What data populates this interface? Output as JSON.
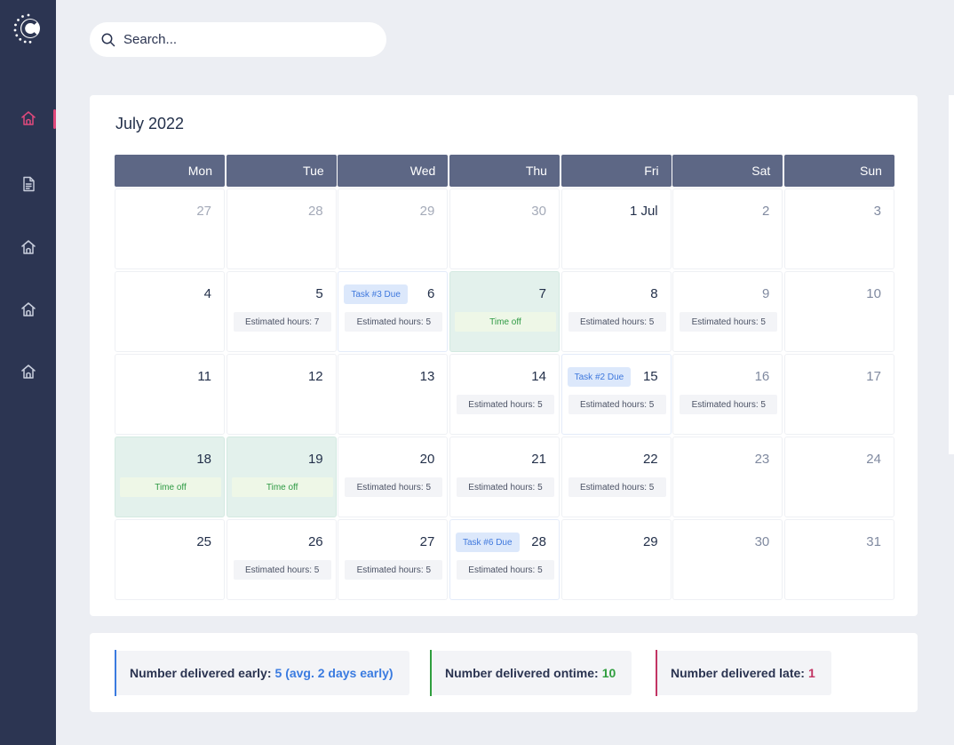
{
  "search": {
    "placeholder": "Search..."
  },
  "calendar": {
    "month_title": "July 2022",
    "weekdays": [
      "Mon",
      "Tue",
      "Wed",
      "Thu",
      "Fri",
      "Sat",
      "Sun"
    ],
    "weeks": [
      [
        {
          "num": "27",
          "style": "muted"
        },
        {
          "num": "28",
          "style": "muted"
        },
        {
          "num": "29",
          "style": "muted"
        },
        {
          "num": "30",
          "style": "muted"
        },
        {
          "num": "1 Jul"
        },
        {
          "num": "2",
          "style": "dim"
        },
        {
          "num": "3",
          "style": "dim"
        }
      ],
      [
        {
          "num": "4"
        },
        {
          "num": "5",
          "est": "Estimated hours:  7"
        },
        {
          "num": "6",
          "task": "Task #3 Due",
          "est": "Estimated hours:  5"
        },
        {
          "num": "7",
          "off": "Time off"
        },
        {
          "num": "8",
          "est": "Estimated hours:  5"
        },
        {
          "num": "9",
          "style": "dim",
          "est": "Estimated hours:  5"
        },
        {
          "num": "10",
          "style": "dim"
        }
      ],
      [
        {
          "num": "11"
        },
        {
          "num": "12"
        },
        {
          "num": "13"
        },
        {
          "num": "14",
          "est": "Estimated hours:  5"
        },
        {
          "num": "15",
          "task": "Task #2 Due",
          "est": "Estimated hours:  5"
        },
        {
          "num": "16",
          "style": "dim",
          "est": "Estimated hours:  5"
        },
        {
          "num": "17",
          "style": "dim"
        }
      ],
      [
        {
          "num": "18",
          "off": "Time off"
        },
        {
          "num": "19",
          "off": "Time off"
        },
        {
          "num": "20",
          "est": "Estimated hours:  5"
        },
        {
          "num": "21",
          "est": "Estimated hours:  5"
        },
        {
          "num": "22",
          "est": "Estimated hours:  5"
        },
        {
          "num": "23",
          "style": "dim"
        },
        {
          "num": "24",
          "style": "dim"
        }
      ],
      [
        {
          "num": "25"
        },
        {
          "num": "26",
          "est": "Estimated hours:  5"
        },
        {
          "num": "27",
          "est": "Estimated hours:  5"
        },
        {
          "num": "28",
          "task": "Task #6 Due",
          "est": "Estimated hours:  5"
        },
        {
          "num": "29"
        },
        {
          "num": "30",
          "style": "dim"
        },
        {
          "num": "31",
          "style": "dim"
        }
      ]
    ]
  },
  "stats": {
    "early_label": "Number delivered early:",
    "early_value": "5 (avg. 2 days early)",
    "ontime_label": "Number delivered ontime:",
    "ontime_value": "10",
    "late_label": "Number delivered late:",
    "late_value": "1"
  },
  "colors": {
    "sidebar": "#2c3552",
    "accent_active": "#e0497c",
    "header_cell": "#5d6785",
    "time_off_bg": "#e3f1ec",
    "task_badge": "#dce8fb",
    "early": "#3a7be0",
    "ontime": "#2f9e3e",
    "late": "#c23463"
  },
  "icons": {
    "nav": [
      "home-icon",
      "document-icon",
      "home-icon",
      "home-icon",
      "home-icon"
    ],
    "search": "search-icon",
    "logo": "brand-logo"
  }
}
